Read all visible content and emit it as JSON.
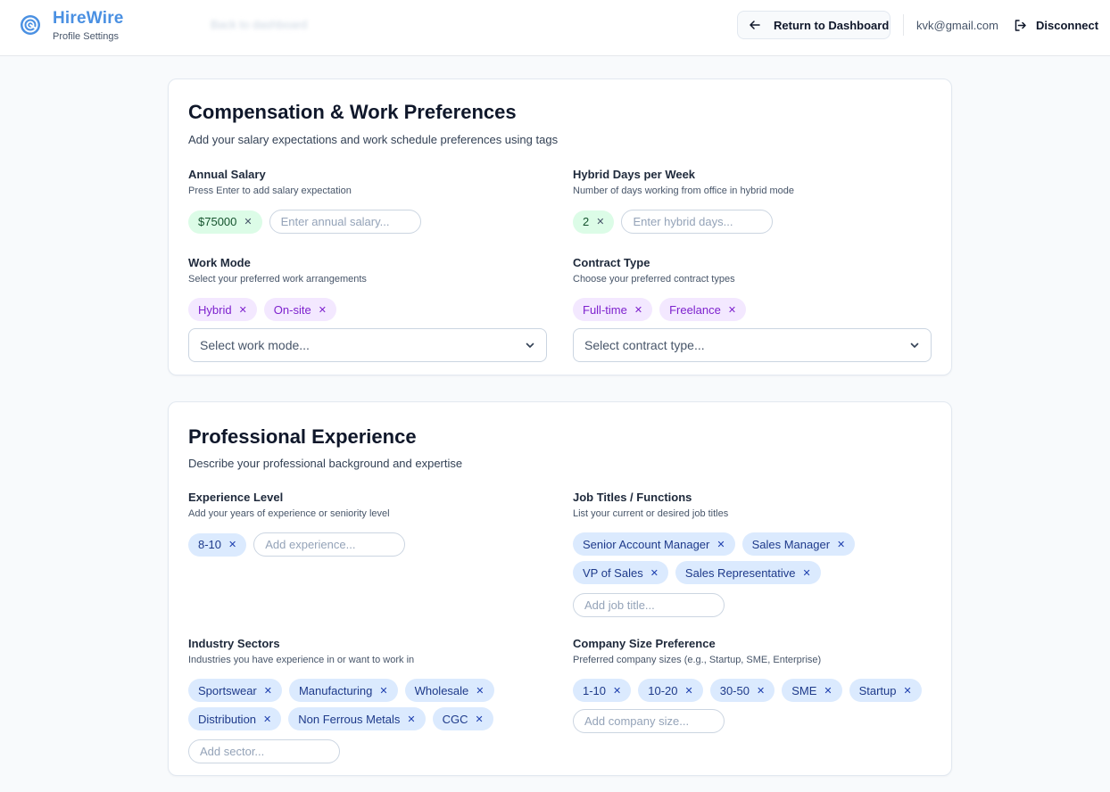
{
  "header": {
    "brand_name": "HireWire",
    "brand_sub": "Profile Settings",
    "ghost_crumb": "Back to dashboard",
    "return_label": "Return to Dashboard",
    "user_email": "kvk@gmail.com",
    "disconnect_label": "Disconnect"
  },
  "compensation": {
    "title": "Compensation & Work Preferences",
    "description": "Add your salary expectations and work schedule preferences using tags",
    "salary": {
      "label": "Annual Salary",
      "help": "Press Enter to add salary expectation",
      "tags": [
        "$75000"
      ],
      "placeholder": "Enter annual salary..."
    },
    "hybrid": {
      "label": "Hybrid Days per Week",
      "help": "Number of days working from office in hybrid mode",
      "tags": [
        "2"
      ],
      "placeholder": "Enter hybrid days..."
    },
    "work_mode": {
      "label": "Work Mode",
      "help": "Select your preferred work arrangements",
      "tags": [
        "Hybrid",
        "On-site"
      ],
      "select_placeholder": "Select work mode..."
    },
    "contract": {
      "label": "Contract Type",
      "help": "Choose your preferred contract types",
      "tags": [
        "Full-time",
        "Freelance"
      ],
      "select_placeholder": "Select contract type..."
    }
  },
  "experience": {
    "title": "Professional Experience",
    "description": "Describe your professional background and expertise",
    "level": {
      "label": "Experience Level",
      "help": "Add your years of experience or seniority level",
      "tags": [
        "8-10"
      ],
      "placeholder": "Add experience..."
    },
    "titles": {
      "label": "Job Titles / Functions",
      "help": "List your current or desired job titles",
      "tags": [
        "Senior Account Manager",
        "Sales Manager",
        "VP of Sales",
        "Sales Representative"
      ],
      "placeholder": "Add job title..."
    },
    "sectors": {
      "label": "Industry Sectors",
      "help": "Industries you have experience in or want to work in",
      "tags": [
        "Sportswear",
        "Manufacturing",
        "Wholesale",
        "Distribution",
        "Non Ferrous Metals",
        "CGC"
      ],
      "placeholder": "Add sector..."
    },
    "company_size": {
      "label": "Company Size Preference",
      "help": "Preferred company sizes (e.g., Startup, SME, Enterprise)",
      "tags": [
        "1-10",
        "10-20",
        "30-50",
        "SME",
        "Startup"
      ],
      "placeholder": "Add company size..."
    }
  },
  "icons": {
    "logo": "hirewire-logo-icon",
    "return": "arrow-left-icon",
    "disconnect": "logout-icon",
    "tag_remove": "close-icon",
    "select": "chevron-down-icon"
  },
  "colors": {
    "brand": "#4a90e2",
    "tag_green_bg": "#dcfce7",
    "tag_purple_bg": "#f3e8ff",
    "tag_purple_text": "#7e22ce",
    "tag_blue_bg": "#dbeafe",
    "tag_blue_text": "#1e3a8a"
  }
}
